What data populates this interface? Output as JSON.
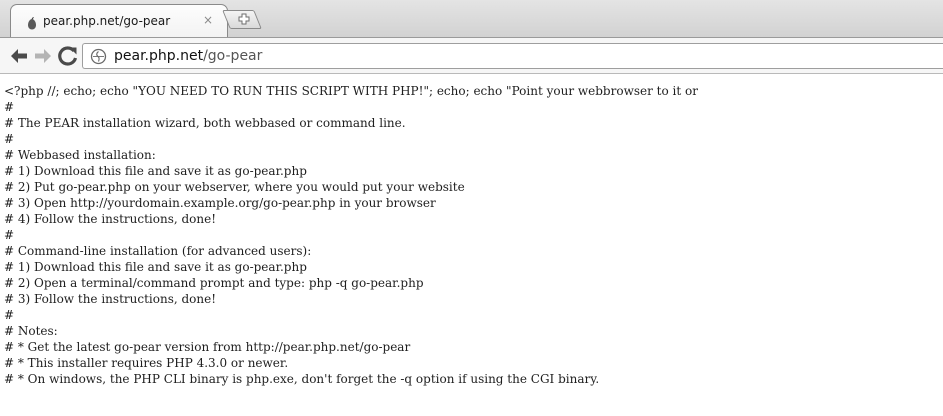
{
  "tab": {
    "title": "pear.php.net/go-pear",
    "close_glyph": "×",
    "favicon": "pear-icon"
  },
  "toolbar": {
    "back_icon": "back-arrow-icon",
    "forward_icon": "forward-arrow-icon",
    "reload_icon": "reload-icon",
    "url_host": "pear.php.net",
    "url_path": "/go-pear"
  },
  "page": {
    "lines": [
      "<?php //; echo; echo \"YOU NEED TO RUN THIS SCRIPT WITH PHP!\"; echo; echo \"Point your webbrowser to it or",
      "#",
      "# The PEAR installation wizard, both webbased or command line.",
      "#",
      "# Webbased installation:",
      "# 1) Download this file and save it as go-pear.php",
      "# 2) Put go-pear.php on your webserver, where you would put your website",
      "# 3) Open http://yourdomain.example.org/go-pear.php in your browser",
      "# 4) Follow the instructions, done!",
      "#",
      "# Command-line installation (for advanced users):",
      "# 1) Download this file and save it as go-pear.php",
      "# 2) Open a terminal/command prompt and type: php -q go-pear.php",
      "# 3) Follow the instructions, done!",
      "#",
      "# Notes:",
      "# * Get the latest go-pear version from http://pear.php.net/go-pear",
      "# * This installer requires PHP 4.3.0 or newer.",
      "# * On windows, the PHP CLI binary is php.exe, don't forget the -q option if using the CGI binary."
    ]
  }
}
